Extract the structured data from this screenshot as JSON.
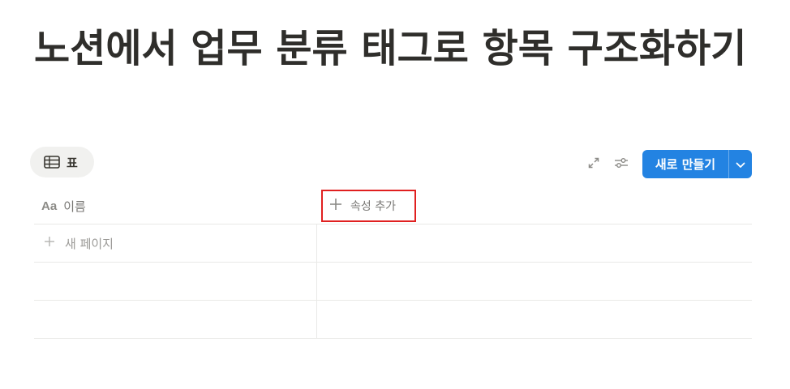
{
  "page": {
    "title": "노션에서 업무 분류 태그로 항목 구조화하기"
  },
  "view_tab": {
    "label": "표",
    "icon": "table-icon"
  },
  "toolbar": {
    "expand_icon": "expand-icon",
    "settings_icon": "sliders-icon",
    "new_button_label": "새로 만들기",
    "dropdown_icon": "chevron-down-icon"
  },
  "table": {
    "name_column_icon": "Aa",
    "name_column_label": "이름",
    "add_property_label": "속성 추가",
    "new_page_label": "새 페이지"
  },
  "colors": {
    "accent": "#2383e2",
    "highlight_box": "#e02020",
    "view_tab_bg": "#f1f1ef",
    "border": "#e9e9e7"
  }
}
